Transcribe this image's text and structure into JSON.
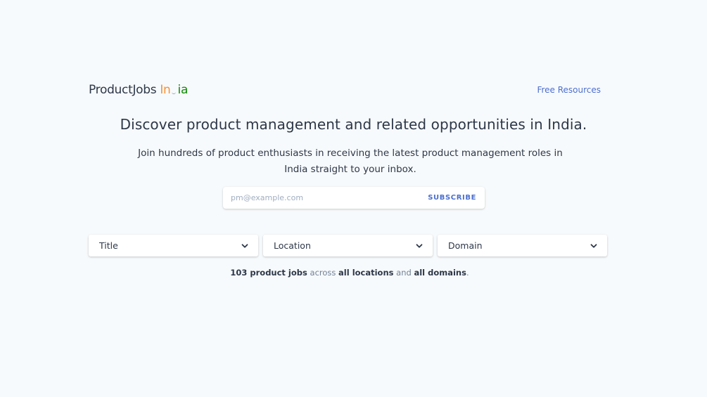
{
  "header": {
    "logo": {
      "brand": "ProductJobs",
      "country_start": "In",
      "country_end": "ia",
      "colors": {
        "saffron": "#f6923a",
        "green": "#138808"
      }
    },
    "nav_link": "Free Resources"
  },
  "hero": {
    "headline": "Discover product management and related opportunities in India.",
    "subheadline": "Join hundreds of product enthusiasts in receiving the latest product management roles in India straight to your inbox."
  },
  "subscribe": {
    "placeholder": "pm@example.com",
    "value": "",
    "button_label": "SUBSCRIBE"
  },
  "filters": [
    {
      "label": "Title",
      "icon": "chevron-down-icon"
    },
    {
      "label": "Location",
      "icon": "chevron-down-icon"
    },
    {
      "label": "Domain",
      "icon": "chevron-down-icon"
    }
  ],
  "summary": {
    "count_text": "103 product jobs",
    "across": "across",
    "location_text": "all locations",
    "and": "and",
    "domain_text": "all domains",
    "period": "."
  },
  "colors": {
    "background": "#f7fafc",
    "text": "#2d3748",
    "accent": "#4c6fcf",
    "muted": "#718096"
  }
}
